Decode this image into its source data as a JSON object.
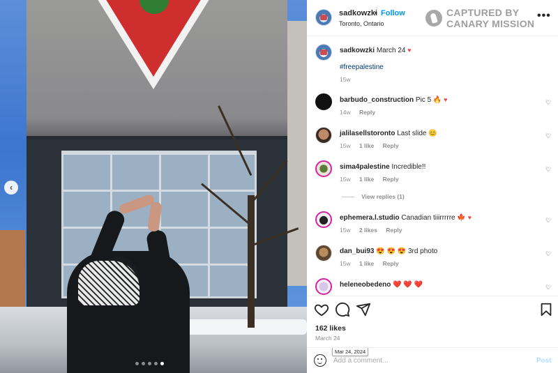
{
  "header": {
    "username": "sadkowzki",
    "separator": "•",
    "follow_label": "Follow",
    "location": "Toronto, Ontario",
    "watermark_line1": "CAPTURED BY",
    "watermark_line2": "CANARY MISSION",
    "more_label": "•••"
  },
  "photo": {
    "prev_label": "‹",
    "carousel_count": 5,
    "active_index": 4
  },
  "caption": {
    "username": "sadkowzki",
    "date": "March 24",
    "hashtag": "#freepalestine",
    "age": "15w"
  },
  "comments": [
    {
      "user": "barbudo_construction",
      "text": "Pic 5 🔥",
      "author_liked": true,
      "age": "14w",
      "likes": "",
      "reply": "Reply"
    },
    {
      "user": "jalilasellstoronto",
      "text": "Last slide 😊",
      "author_liked": false,
      "age": "15w",
      "likes": "1 like",
      "reply": "Reply"
    },
    {
      "user": "sima4palestine",
      "text": "Incredible!!",
      "author_liked": false,
      "age": "15w",
      "likes": "1 like",
      "reply": "Reply",
      "view_replies": "View replies (1)"
    },
    {
      "user": "ephemera.l.studio",
      "text": "Canadian tiiirrrrre 🍁",
      "author_liked": true,
      "age": "15w",
      "likes": "2 likes",
      "reply": "Reply"
    },
    {
      "user": "dan_bui93",
      "text": "😍 😍 😍 3rd photo",
      "author_liked": false,
      "age": "15w",
      "likes": "1 like",
      "reply": "Reply"
    },
    {
      "user": "heleneobedeno",
      "text": "❤️ ❤️ ❤️",
      "author_liked": false,
      "age": "",
      "likes": "",
      "reply": ""
    }
  ],
  "actions": {
    "likes": "162 likes",
    "date": "March 24",
    "date_tooltip": "Mar 24, 2024"
  },
  "compose": {
    "placeholder": "Add a comment...",
    "post_label": "Post"
  },
  "colors": {
    "link_blue": "#0095f6",
    "hashtag": "#00376b",
    "heart_red": "#ed4956",
    "muted": "#8e8e8e"
  }
}
